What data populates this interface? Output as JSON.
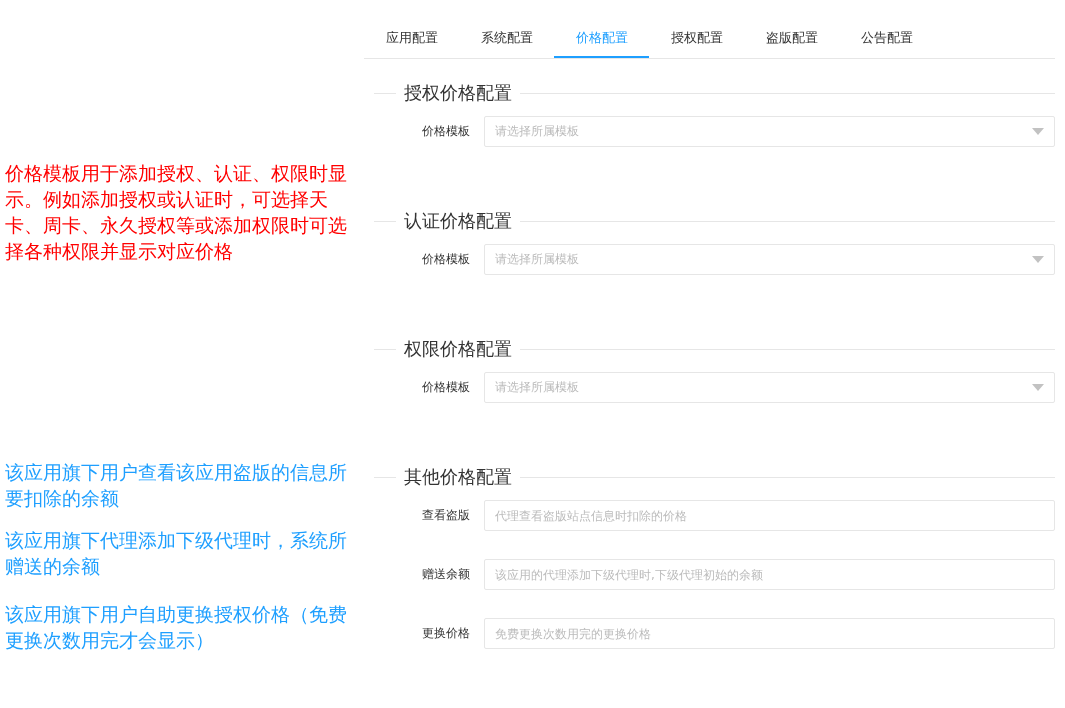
{
  "tabs": [
    {
      "label": "应用配置",
      "selected": false
    },
    {
      "label": "系统配置",
      "selected": false
    },
    {
      "label": "价格配置",
      "selected": true
    },
    {
      "label": "授权配置",
      "selected": false
    },
    {
      "label": "盗版配置",
      "selected": false
    },
    {
      "label": "公告配置",
      "selected": false
    }
  ],
  "sections": [
    {
      "title": "授权价格配置",
      "fields": [
        {
          "label": "价格模板",
          "kind": "select",
          "placeholder": "请选择所属模板"
        }
      ]
    },
    {
      "title": "认证价格配置",
      "fields": [
        {
          "label": "价格模板",
          "kind": "select",
          "placeholder": "请选择所属模板"
        }
      ]
    },
    {
      "title": "权限价格配置",
      "fields": [
        {
          "label": "价格模板",
          "kind": "select",
          "placeholder": "请选择所属模板"
        }
      ]
    },
    {
      "title": "其他价格配置",
      "fields": [
        {
          "label": "查看盗版",
          "kind": "input",
          "placeholder": "代理查看盗版站点信息时扣除的价格"
        },
        {
          "label": "赠送余额",
          "kind": "input",
          "placeholder": "该应用的代理添加下级代理时,下级代理初始的余额"
        },
        {
          "label": "更换价格",
          "kind": "input",
          "placeholder": "免费更换次数用完的更换价格"
        }
      ]
    }
  ],
  "notes": [
    {
      "text": "价格模板用于添加授权、认证、权限时显示。例如添加授权或认证时，可选择天卡、周卡、永久授权等或添加权限时可选择各种权限并显示对应价格",
      "color": "#ff0000"
    },
    {
      "text": "该应用旗下用户查看该应用盗版的信息所要扣除的余额",
      "color": "#1e9fff"
    },
    {
      "text": "该应用旗下代理添加下级代理时，系统所赠送的余额",
      "color": "#1e9fff"
    },
    {
      "text": "该应用旗下用户自助更换授权价格（免费更换次数用完才会显示）",
      "color": "#1e9fff"
    }
  ]
}
